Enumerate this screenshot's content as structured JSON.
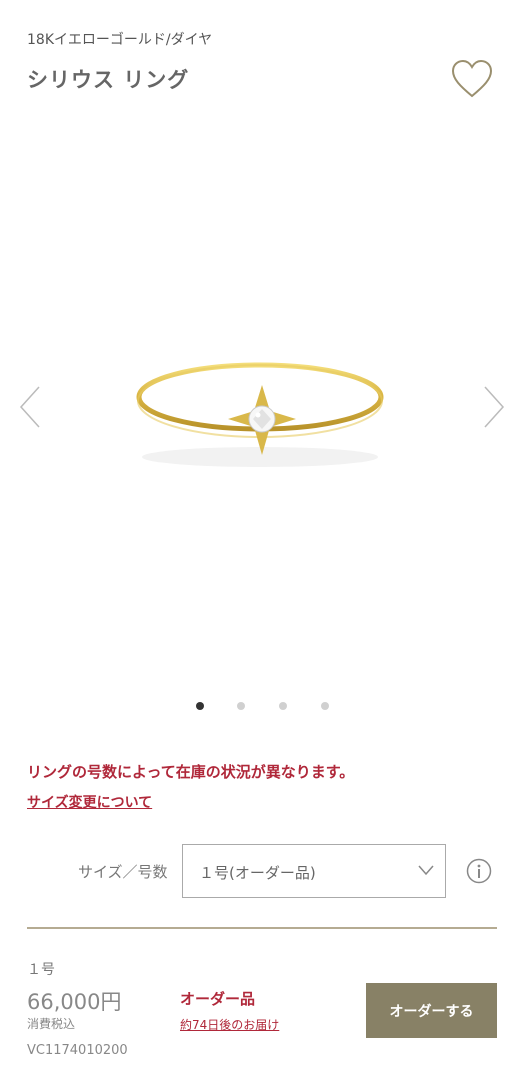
{
  "product": {
    "material": "18Kイエローゴールド/ダイヤ",
    "name": "シリウス リング"
  },
  "icons": {
    "favorite": "heart-outline-icon",
    "prev": "chevron-left-icon",
    "next": "chevron-right-icon",
    "info": "info-circle-icon",
    "dropdown": "chevron-down-icon"
  },
  "gallery": {
    "image_count": 4,
    "current_index": 0
  },
  "notice": {
    "stock_message": "リングの号数によって在庫の状況が異なります。",
    "size_change_link": "サイズ変更について"
  },
  "size_selector": {
    "label": "サイズ／号数",
    "selected": "１号(オーダー品)"
  },
  "purchase": {
    "size": "１号",
    "price": "66,000円",
    "tax_note": "消費税込",
    "product_code": "VC1174010200",
    "order_type": "オーダー品",
    "delivery": "約74日後のお届け",
    "button_label": "オーダーする"
  },
  "colors": {
    "accent_red": "#b0283a",
    "button": "#888166",
    "divider": "#b5ab92"
  }
}
